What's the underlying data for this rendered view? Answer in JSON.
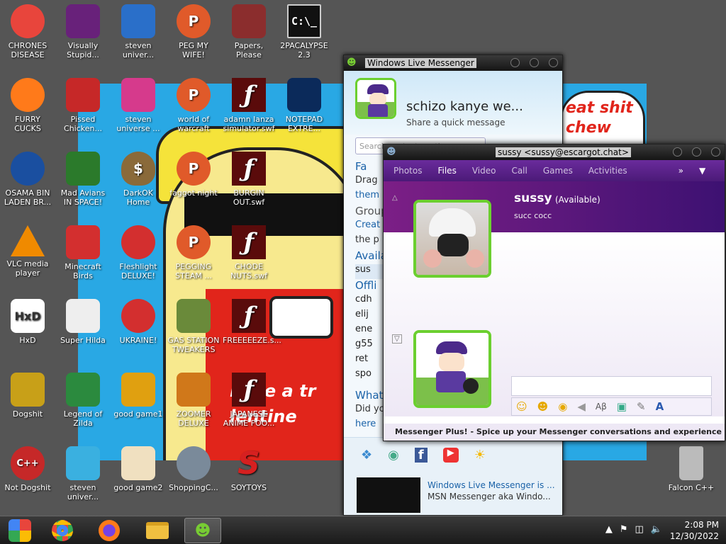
{
  "desktop_icons": [
    {
      "label": "CHRONES DISEASE",
      "icon": "chrome-icon",
      "color": "#e8453c"
    },
    {
      "label": "Visually Stupid...",
      "icon": "visual-studio-icon",
      "color": "#68217a"
    },
    {
      "label": "steven univer...",
      "icon": "steam-2-icon",
      "color": "#2a6fc9"
    },
    {
      "label": "PEG MY WIFE!",
      "icon": "peggle-icon",
      "color": "#e05a2a"
    },
    {
      "label": "Papers, Please",
      "icon": "papers-please-icon",
      "color": "#8b2d2d"
    },
    {
      "label": "2PACALYPSE 2.3",
      "icon": "cmd-icon",
      "color": "#111"
    },
    {
      "label": "FURRY CUCKS",
      "icon": "firefox-icon",
      "color": "#ff7a1a"
    },
    {
      "label": "Pissed Chicken...",
      "icon": "angry-birds-seasons-icon",
      "color": "#c62828"
    },
    {
      "label": "steven universe ...",
      "icon": "gem-icon",
      "color": "#d63a8c"
    },
    {
      "label": "world of warcraft",
      "icon": "peggle-icon",
      "color": "#e05a2a"
    },
    {
      "label": "adamn lanza simulator.swf",
      "icon": "flash-icon",
      "color": "#5a0b0b"
    },
    {
      "label": "NOTEPAD EXTRE...",
      "icon": "notepad-icon",
      "color": "#0b2a5a"
    },
    {
      "label": "OSAMA BIN LADEN BR...",
      "icon": "obama-logo-icon",
      "color": "#1a4fa0"
    },
    {
      "label": "Mad Avians IN SPACE!",
      "icon": "angry-birds-space-icon",
      "color": "#2b7a2b"
    },
    {
      "label": "DarkOK Home",
      "icon": "money-bag-icon",
      "color": "#8a6a3a"
    },
    {
      "label": "faggot night",
      "icon": "peggle-nights-icon",
      "color": "#e05a2a"
    },
    {
      "label": "BURGIN OUT.swf",
      "icon": "flash-icon",
      "color": "#5a0b0b"
    },
    {
      "label": "VLC media player",
      "icon": "vlc-icon",
      "color": "#f08a00"
    },
    {
      "label": "Minecraft Birds",
      "icon": "angry-bird-icon",
      "color": "#d32f2f"
    },
    {
      "label": "Fleshlight DELUXE!",
      "icon": "red-fuzzball-icon",
      "color": "#d32f2f"
    },
    {
      "label": "PEGGING STEAM ...",
      "icon": "peggle-icon",
      "color": "#e05a2a"
    },
    {
      "label": "CHODE NUTS.swf",
      "icon": "flash-icon",
      "color": "#5a0b0b"
    },
    {
      "label": "HxD",
      "icon": "hxd-icon",
      "color": "#ffffff"
    },
    {
      "label": "Super Hilda",
      "icon": "pixel-cat-icon",
      "color": "#eee"
    },
    {
      "label": "UKRAINE!",
      "icon": "radiation-icon",
      "color": "#d32f2f"
    },
    {
      "label": "GAS STATION TWEAKERS",
      "icon": "plants-zombies-icon",
      "color": "#6a8a3a"
    },
    {
      "label": "FREEEEEZE.s...",
      "icon": "flash-icon",
      "color": "#5a0b0b"
    },
    {
      "label": "Dogshit",
      "icon": "cpp-quill-icon",
      "color": "#c8a018"
    },
    {
      "label": "Legend of Zilda",
      "icon": "zelda-sprite-icon",
      "color": "#2b8a3e"
    },
    {
      "label": "good game1",
      "icon": "gold-tile-icon",
      "color": "#e0a010"
    },
    {
      "label": "ZOOMER DELUXE",
      "icon": "zuma-icon",
      "color": "#d0781a"
    },
    {
      "label": "JAPANESE ANIME FOO...",
      "icon": "flash-icon",
      "color": "#5a0b0b"
    },
    {
      "label": "Not Dogshit",
      "icon": "dev-cpp-icon",
      "color": "#c62828"
    },
    {
      "label": "steven univer...",
      "icon": "diamond-icon",
      "color": "#3ab0e0"
    },
    {
      "label": "good game2",
      "icon": "torii-tile-icon",
      "color": "#f0e0c0"
    },
    {
      "label": "ShoppingC...",
      "icon": "flash-player-icon",
      "color": "#7a8a9a"
    },
    {
      "label": "SOYTOYS",
      "icon": "soytoys-icon",
      "color": "#d62020"
    },
    {
      "label": "Falcon C++",
      "icon": "recycle-bin-icon",
      "color": "#bbbbbb"
    }
  ],
  "wallpaper": {
    "bubble_line1": "eat shit",
    "bubble_line2": "chew",
    "banner_line1": "have a tr",
    "banner_line2": "lentine"
  },
  "wlm_main": {
    "title": "Windows Live Messenger",
    "display_name": "schizo kanye we...",
    "psm": "Share a quick message",
    "search_placeholder": "Search contacts or the w...",
    "sections": [
      "Fa",
      "Drag",
      "them",
      "Group",
      "Creat",
      "the p",
      "Availa",
      "sus",
      "Offli",
      "cdh",
      "elij",
      "ene",
      "g55",
      "ret",
      "spo",
      "What",
      "Did yo",
      "here"
    ],
    "news_title": "Windows Live Messenger is ...",
    "news_sub": "MSN Messenger aka Windo..."
  },
  "chat": {
    "title": "sussy <sussy@escargot.chat>",
    "tabs": [
      "Photos",
      "Files",
      "Video",
      "Call",
      "Games",
      "Activities"
    ],
    "active_tab": "Files",
    "contact_name": "sussy",
    "contact_status": "(Available)",
    "contact_psm": "succ cocc",
    "status_bar": "Messenger Plus! - Spice up your Messenger conversations and experience w..."
  },
  "taskbar": {
    "time": "2:08 PM",
    "date": "12/30/2022"
  }
}
